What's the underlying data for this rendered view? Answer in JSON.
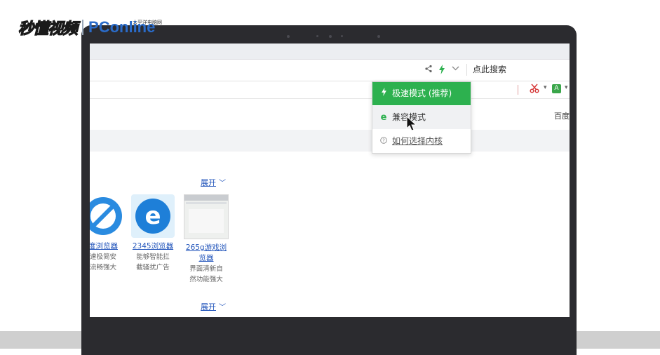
{
  "watermark": {
    "brand_cn": "秒懂视频",
    "brand_en": "PConline",
    "brand_sub": "太平洋电脑网"
  },
  "address_bar": {
    "share_icon": "share-icon",
    "mode_icon": "lightning-icon",
    "chevron_icon": "chevron-down-icon",
    "search_label": "点此搜索"
  },
  "toolbar": {
    "scissor_icon": "scissor-icon",
    "translate_icon": "translate-icon",
    "translate_glyph": "A"
  },
  "nav": {
    "baidu_label": "百度"
  },
  "kernel_menu": {
    "fast_mode": "极速模式 (推荐)",
    "compat_mode": "兼容模式",
    "help": "如何选择内核"
  },
  "content": {
    "expand_label": "展开",
    "cards": [
      {
        "name": "度浏览器",
        "desc1": "速极简安",
        "desc2": "流畅强大",
        "desc3": ""
      },
      {
        "name": "2345浏览器",
        "desc1": "能够智能拦",
        "desc2": "截骚扰广告",
        "desc3": ""
      },
      {
        "name": "265g游戏浏",
        "name2": "览器",
        "desc1": "界面清新自",
        "desc2": "然功能强大",
        "desc3": ""
      }
    ]
  },
  "colors": {
    "accent_green": "#2db14f",
    "link_blue": "#2255bb",
    "ie_blue": "#1e7fd8"
  }
}
